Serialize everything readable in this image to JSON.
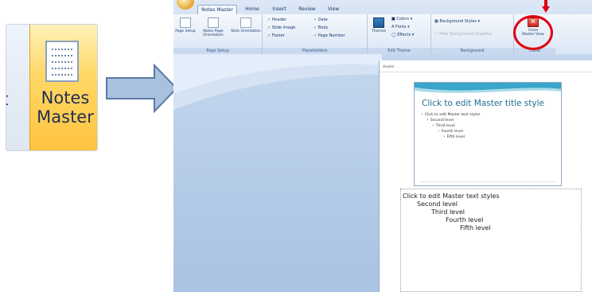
{
  "zoom": {
    "partial_text": "t",
    "button_label_line1": "Notes",
    "button_label_line2": "Master"
  },
  "ribbon": {
    "tabs": [
      "Notes Master",
      "Home",
      "Insert",
      "Review",
      "View"
    ],
    "active_tab": "Notes Master",
    "groups": {
      "page_setup": {
        "title": "Page Setup",
        "buttons": [
          "Page Setup",
          "Notes Page Orientation",
          "Slide Orientation"
        ]
      },
      "placeholders": {
        "title": "Placeholders",
        "checkboxes": [
          "Header",
          "Slide Image",
          "Footer",
          "Date",
          "Body",
          "Page Number"
        ]
      },
      "edit_theme": {
        "title": "Edit Theme",
        "themes_label": "Themes",
        "colors": "Colors",
        "fonts": "Fonts",
        "effects": "Effects"
      },
      "background": {
        "title": "Background",
        "background_styles": "Background Styles",
        "hide_graphics": "Hide Background Graphics"
      },
      "close": {
        "title": "Close",
        "close_label_line1": "Close",
        "close_label_line2": "Master View"
      }
    }
  },
  "page": {
    "header": "Header",
    "date": "",
    "slide": {
      "title": "Click to edit Master title style",
      "levels": [
        "Click to edit Master text styles",
        "Second level",
        "Third level",
        "Fourth level",
        "Fifth level"
      ]
    },
    "notes": {
      "levels": [
        "Click to edit Master text styles",
        "Second level",
        "Third level",
        "Fourth level",
        "Fifth level"
      ]
    }
  },
  "colors": {
    "highlight": "#ffc23d",
    "arrow_fill": "#a9c1de",
    "arrow_stroke": "#5b7aa3",
    "annotation_red": "#e00010",
    "slide_title": "#1e6f8f"
  }
}
